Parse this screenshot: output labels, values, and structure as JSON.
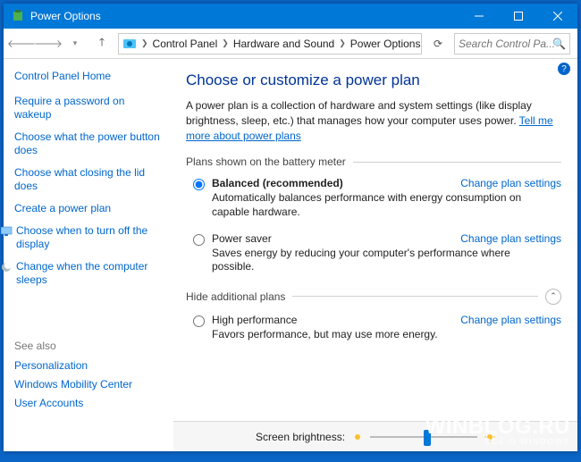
{
  "titlebar": {
    "title": "Power Options"
  },
  "breadcrumb": {
    "items": [
      "Control Panel",
      "Hardware and Sound",
      "Power Options"
    ]
  },
  "search": {
    "placeholder": "Search Control Pa..."
  },
  "sidebar": {
    "home": "Control Panel Home",
    "links": [
      "Require a password on wakeup",
      "Choose what the power button does",
      "Choose what closing the lid does",
      "Create a power plan",
      "Choose when to turn off the display",
      "Change when the computer sleeps"
    ]
  },
  "seealso": {
    "head": "See also",
    "links": [
      "Personalization",
      "Windows Mobility Center",
      "User Accounts"
    ]
  },
  "content": {
    "heading": "Choose or customize a power plan",
    "description_pre": "A power plan is a collection of hardware and system settings (like display brightness, sleep, etc.) that manages how your computer uses power. ",
    "description_link": "Tell me more about power plans",
    "section1": "Plans shown on the battery meter",
    "section2": "Hide additional plans",
    "change_link": "Change plan settings",
    "plans": [
      {
        "name": "Balanced (recommended)",
        "desc": "Automatically balances performance with energy consumption on capable hardware.",
        "selected": true,
        "bold": true
      },
      {
        "name": "Power saver",
        "desc": "Saves energy by reducing your computer's performance where possible.",
        "selected": false,
        "bold": false
      }
    ],
    "hidden_plans": [
      {
        "name": "High performance",
        "desc": "Favors performance, but may use more energy.",
        "selected": false,
        "bold": false
      }
    ],
    "brightness_label": "Screen brightness:"
  },
  "watermark": {
    "big": "WINBLOG.RU",
    "small": "ВСЁ О WINDOWS"
  }
}
